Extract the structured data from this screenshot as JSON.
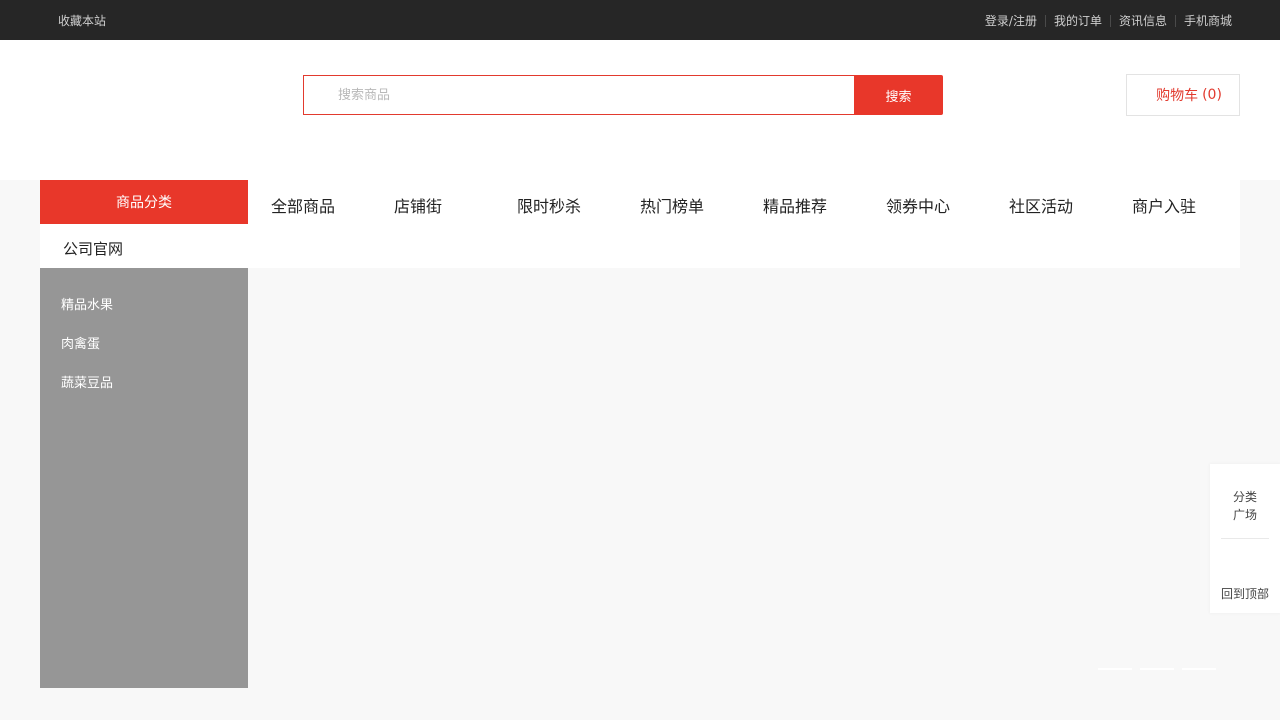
{
  "topbar": {
    "favorite": "收藏本站",
    "links": [
      "登录/注册",
      "我的订单",
      "资讯信息",
      "手机商城"
    ]
  },
  "header": {
    "search_placeholder": "搜索商品",
    "search_value": "",
    "search_button": "搜索",
    "cart_label": "购物车",
    "cart_count": "(0)"
  },
  "nav": {
    "category_button": "商品分类",
    "official_site": "公司官网",
    "items": [
      "全部商品",
      "店铺街",
      "限时秒杀",
      "热门榜单",
      "精品推荐",
      "领券中心",
      "社区活动",
      "商户入驻"
    ]
  },
  "sidebar": {
    "items": [
      "精品水果",
      "肉禽蛋",
      "蔬菜豆品"
    ]
  },
  "right_tools": {
    "category_line1": "分类",
    "category_line2": "广场",
    "back_to_top": "回到顶部"
  },
  "carousel": {
    "dot_count": 3
  },
  "colors": {
    "accent": "#e8372a",
    "topbar_bg": "#262626",
    "sidebar_bg": "#969696",
    "page_bg": "#f8f8f8"
  }
}
